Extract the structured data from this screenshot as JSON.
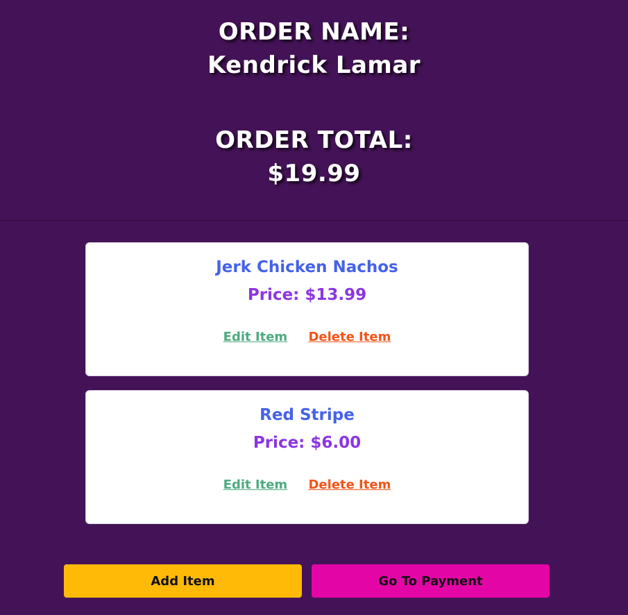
{
  "header": {
    "order_name_label": "ORDER NAME:",
    "order_name": "Kendrick Lamar",
    "order_total_label": "ORDER TOTAL:",
    "order_total": "$19.99"
  },
  "items": [
    {
      "name": "Jerk Chicken Nachos",
      "price": "Price: $13.99",
      "edit_label": "Edit Item",
      "delete_label": "Delete Item"
    },
    {
      "name": "Red Stripe",
      "price": "Price: $6.00",
      "edit_label": "Edit Item",
      "delete_label": "Delete Item"
    }
  ],
  "actions": {
    "add_item_label": "Add Item",
    "payment_label": "Go To Payment"
  },
  "colors": {
    "background": "#441357",
    "item_name": "#4562e8",
    "item_price": "#8c35e2",
    "edit_link": "#4dab80",
    "delete_link": "#f25418",
    "add_button": "#ffb907",
    "payment_button": "#e405a6"
  }
}
